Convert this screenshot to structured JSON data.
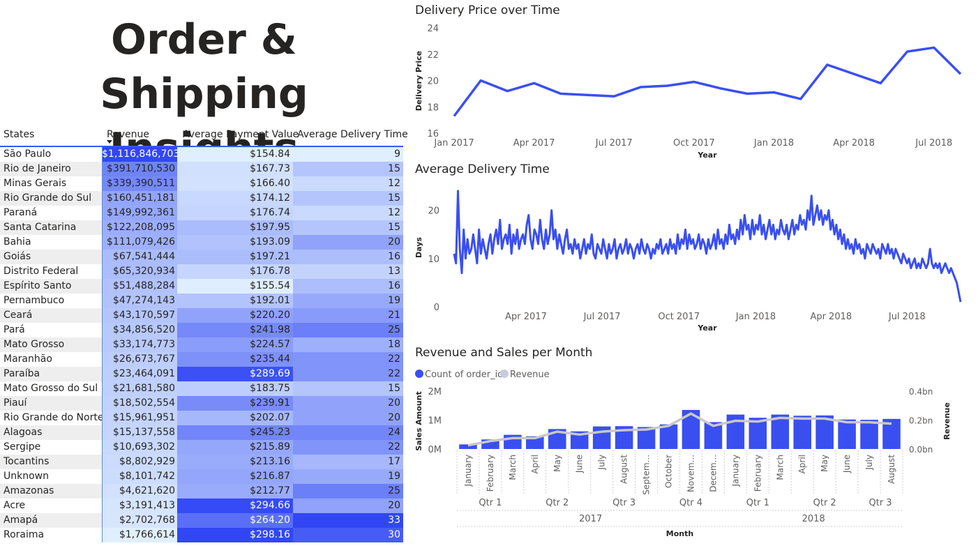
{
  "page_title": "Order & Shipping Insights",
  "table": {
    "headers": [
      "States",
      "Revenue",
      "Average Payment Value",
      "Average Delivery Time"
    ],
    "rows": [
      {
        "state": "São Paulo",
        "revenue": "$1,116,846,703",
        "payment": "$154.84",
        "delivery": "9"
      },
      {
        "state": "Rio de Janeiro",
        "revenue": "$391,710,530",
        "payment": "$167.73",
        "delivery": "15"
      },
      {
        "state": "Minas Gerais",
        "revenue": "$339,390,511",
        "payment": "$166.40",
        "delivery": "12"
      },
      {
        "state": "Rio Grande do Sul",
        "revenue": "$160,451,181",
        "payment": "$174.12",
        "delivery": "15"
      },
      {
        "state": "Paraná",
        "revenue": "$149,992,361",
        "payment": "$176.74",
        "delivery": "12"
      },
      {
        "state": "Santa Catarina",
        "revenue": "$122,208,095",
        "payment": "$197.95",
        "delivery": "15"
      },
      {
        "state": "Bahia",
        "revenue": "$111,079,426",
        "payment": "$193.09",
        "delivery": "20"
      },
      {
        "state": "Goiás",
        "revenue": "$67,541,444",
        "payment": "$197.21",
        "delivery": "16"
      },
      {
        "state": "Distrito Federal",
        "revenue": "$65,320,934",
        "payment": "$176.78",
        "delivery": "13"
      },
      {
        "state": "Espírito Santo",
        "revenue": "$51,488,284",
        "payment": "$155.54",
        "delivery": "16"
      },
      {
        "state": "Pernambuco",
        "revenue": "$47,274,143",
        "payment": "$192.01",
        "delivery": "19"
      },
      {
        "state": "Ceará",
        "revenue": "$43,170,597",
        "payment": "$220.20",
        "delivery": "21"
      },
      {
        "state": "Pará",
        "revenue": "$34,856,520",
        "payment": "$241.98",
        "delivery": "25"
      },
      {
        "state": "Mato Grosso",
        "revenue": "$33,174,773",
        "payment": "$224.57",
        "delivery": "18"
      },
      {
        "state": "Maranhão",
        "revenue": "$26,673,767",
        "payment": "$235.44",
        "delivery": "22"
      },
      {
        "state": "Paraíba",
        "revenue": "$23,464,091",
        "payment": "$289.69",
        "delivery": "22"
      },
      {
        "state": "Mato Grosso do Sul",
        "revenue": "$21,681,580",
        "payment": "$183.75",
        "delivery": "15"
      },
      {
        "state": "Piauí",
        "revenue": "$18,502,554",
        "payment": "$239.91",
        "delivery": "20"
      },
      {
        "state": "Rio Grande do Norte",
        "revenue": "$15,961,951",
        "payment": "$202.07",
        "delivery": "20"
      },
      {
        "state": "Alagoas",
        "revenue": "$15,137,558",
        "payment": "$245.23",
        "delivery": "24"
      },
      {
        "state": "Sergipe",
        "revenue": "$10,693,302",
        "payment": "$215.89",
        "delivery": "22"
      },
      {
        "state": "Tocantins",
        "revenue": "$8,802,929",
        "payment": "$213.16",
        "delivery": "17"
      },
      {
        "state": "Unknown",
        "revenue": "$8,101,742",
        "payment": "$216.87",
        "delivery": "19"
      },
      {
        "state": "Amazonas",
        "revenue": "$4,621,620",
        "payment": "$212.77",
        "delivery": "25"
      },
      {
        "state": "Acre",
        "revenue": "$3,191,413",
        "payment": "$294.66",
        "delivery": "20"
      },
      {
        "state": "Amapá",
        "revenue": "$2,702,768",
        "payment": "$264.20",
        "delivery": "33"
      },
      {
        "state": "Roraima",
        "revenue": "$1,766,614",
        "payment": "$298.16",
        "delivery": "30"
      }
    ]
  },
  "colors": {
    "accent": "#3a4ff0",
    "line_grey": "#c8c8c8",
    "legend_grey": "#c8ccd8",
    "heat_low": "#e0efff",
    "heat_high": "#3147f5"
  },
  "chart_data": [
    {
      "type": "line",
      "title": "Delivery Price over Time",
      "xlabel": "Year",
      "ylabel": "Delivery Price",
      "x": [
        "2017-01",
        "2017-02",
        "2017-03",
        "2017-04",
        "2017-05",
        "2017-06",
        "2017-07",
        "2017-08",
        "2017-09",
        "2017-10",
        "2017-11",
        "2017-12",
        "2018-01",
        "2018-02",
        "2018-03",
        "2018-04",
        "2018-05",
        "2018-06",
        "2018-07",
        "2018-08"
      ],
      "values": [
        17.3,
        20.0,
        19.2,
        19.8,
        19.0,
        18.9,
        18.8,
        19.5,
        19.6,
        19.9,
        19.4,
        19.0,
        19.1,
        18.6,
        21.2,
        20.5,
        19.8,
        22.2,
        22.5,
        20.5
      ],
      "xticks": [
        "Jan 2017",
        "Apr 2017",
        "Jul 2017",
        "Oct 2017",
        "Jan 2018",
        "Apr 2018",
        "Jul 2018"
      ],
      "ylim": [
        16,
        24
      ],
      "yticks": [
        16,
        18,
        20,
        22,
        24
      ]
    },
    {
      "type": "line",
      "title": "Average Delivery Time",
      "xlabel": "Year",
      "ylabel": "Days",
      "x_start": "2017-01-05",
      "x_end": "2018-09-03",
      "xticks": [
        "Apr 2017",
        "Jul 2017",
        "Oct 2017",
        "Jan 2018",
        "Apr 2018",
        "Jul 2018"
      ],
      "ylim": [
        0,
        25
      ],
      "yticks": [
        0,
        10,
        20
      ],
      "values": [
        11,
        9,
        24,
        12,
        7,
        16,
        10,
        14,
        11,
        12,
        15,
        12,
        9,
        16,
        11,
        14,
        12,
        10,
        13,
        15,
        11,
        14,
        16,
        13,
        18,
        12,
        14,
        15,
        13,
        17,
        11,
        15,
        13,
        16,
        12,
        14,
        15,
        13,
        17,
        19,
        14,
        12,
        16,
        15,
        13,
        18,
        14,
        12,
        16,
        13,
        15,
        20,
        14,
        16,
        12,
        15,
        13,
        11,
        14,
        16,
        12,
        13,
        11,
        14,
        12,
        13,
        10,
        12,
        14,
        11,
        13,
        12,
        15,
        11,
        10,
        13,
        12,
        11,
        14,
        12,
        10,
        13,
        11,
        12,
        14,
        10,
        12,
        13,
        11,
        12,
        14,
        11,
        13,
        12,
        10,
        12,
        13,
        11,
        14,
        12,
        11,
        13,
        12,
        10,
        12,
        11,
        13,
        12,
        14,
        11,
        12,
        13,
        11,
        14,
        12,
        13,
        11,
        15,
        12,
        14,
        13,
        16,
        12,
        15,
        13,
        14,
        12,
        13,
        15,
        12,
        14,
        13,
        11,
        14,
        12,
        13,
        15,
        12,
        16,
        13,
        14,
        12,
        15,
        13,
        17,
        14,
        15,
        13,
        16,
        14,
        18,
        15,
        19,
        16,
        17,
        14,
        18,
        15,
        17,
        16,
        19,
        15,
        17,
        14,
        16,
        18,
        15,
        17,
        14,
        16,
        15,
        18,
        16,
        15,
        17,
        14,
        16,
        18,
        15,
        17,
        16,
        19,
        17,
        18,
        16,
        20,
        18,
        23,
        17,
        19,
        21,
        18,
        20,
        17,
        19,
        18,
        20,
        16,
        18,
        15,
        17,
        14,
        16,
        13,
        15,
        12,
        14,
        12,
        13,
        11,
        14,
        12,
        13,
        11,
        12,
        10,
        13,
        12,
        11,
        13,
        12,
        11,
        12,
        10,
        13,
        12,
        11,
        13,
        11,
        12,
        10,
        12,
        11,
        10,
        9,
        11,
        10,
        9,
        10,
        8,
        9,
        10,
        8,
        9,
        8,
        10,
        9,
        8,
        9,
        12,
        9,
        8,
        9,
        8,
        9,
        7,
        8,
        9,
        8,
        7,
        8,
        7,
        6,
        5,
        3,
        1
      ]
    },
    {
      "type": "bar+line",
      "title": "Revenue and Sales per Month",
      "xlabel": "Month",
      "ylabel": "Sales Amount",
      "y2label": "Revenue",
      "categories": [
        "January",
        "February",
        "March",
        "April",
        "May",
        "June",
        "July",
        "August",
        "Septem...",
        "October",
        "Novem...",
        "Decem...",
        "January",
        "February",
        "March",
        "April",
        "May",
        "June",
        "July",
        "August"
      ],
      "quarters": [
        {
          "label": "Qtr 1",
          "span": 3
        },
        {
          "label": "Qtr 2",
          "span": 3
        },
        {
          "label": "Qtr 3",
          "span": 3
        },
        {
          "label": "Qtr 4",
          "span": 3
        },
        {
          "label": "Qtr 1",
          "span": 3
        },
        {
          "label": "Qtr 2",
          "span": 3
        },
        {
          "label": "Qtr 3",
          "span": 2
        }
      ],
      "years": [
        {
          "label": "2017",
          "span": 12
        },
        {
          "label": "2018",
          "span": 8
        }
      ],
      "series": [
        {
          "name": "Count of order_id",
          "type": "bar",
          "values": [
            160000,
            330000,
            490000,
            440000,
            690000,
            610000,
            780000,
            790000,
            760000,
            850000,
            1350000,
            930000,
            1190000,
            1080000,
            1190000,
            1150000,
            1160000,
            1020000,
            1010000,
            1040000
          ]
        },
        {
          "name": "Revenue",
          "type": "line",
          "values": [
            25000000,
            55000000,
            75000000,
            75000000,
            120000000,
            100000000,
            120000000,
            130000000,
            135000000,
            160000000,
            245000000,
            160000000,
            195000000,
            190000000,
            215000000,
            210000000,
            210000000,
            185000000,
            185000000,
            175000000
          ]
        }
      ],
      "ylim": [
        0,
        2000000
      ],
      "yticks": [
        "0M",
        "1M",
        "2M"
      ],
      "y2lim": [
        0,
        400000000
      ],
      "y2ticks": [
        "0.0bn",
        "0.2bn",
        "0.4bn"
      ],
      "legend": [
        "Count of order_id",
        "Revenue"
      ],
      "legend_position": "top-left"
    }
  ]
}
